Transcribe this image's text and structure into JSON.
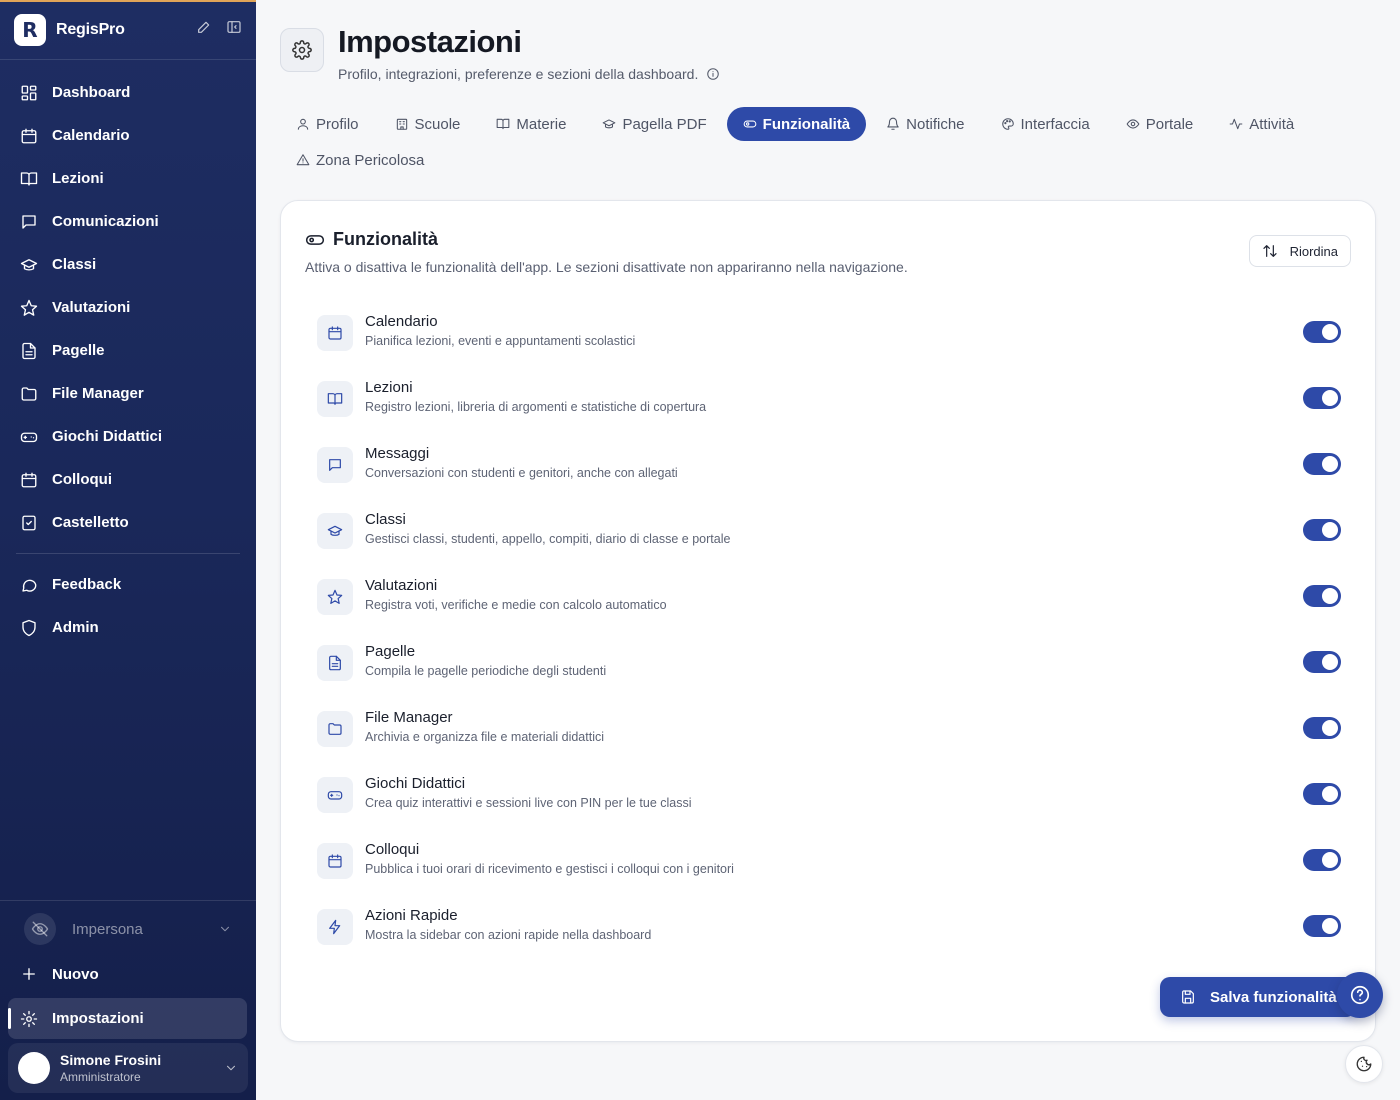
{
  "brand": {
    "name": "RegisPro",
    "logo_letter": "R"
  },
  "sidebar": {
    "items": [
      {
        "label": "Dashboard",
        "icon": "dashboard-icon"
      },
      {
        "label": "Calendario",
        "icon": "calendar-icon"
      },
      {
        "label": "Lezioni",
        "icon": "book-open-icon"
      },
      {
        "label": "Comunicazioni",
        "icon": "message-icon"
      },
      {
        "label": "Classi",
        "icon": "graduation-cap-icon"
      },
      {
        "label": "Valutazioni",
        "icon": "star-icon"
      },
      {
        "label": "Pagelle",
        "icon": "file-text-icon"
      },
      {
        "label": "File Manager",
        "icon": "folder-icon"
      },
      {
        "label": "Giochi Didattici",
        "icon": "gamepad-icon"
      },
      {
        "label": "Colloqui",
        "icon": "calendar-check-icon"
      },
      {
        "label": "Castelletto",
        "icon": "clipboard-check-icon"
      }
    ],
    "secondary": [
      {
        "label": "Feedback",
        "icon": "chat-bubble-icon"
      },
      {
        "label": "Admin",
        "icon": "shield-icon"
      }
    ],
    "impersona": "Impersona",
    "nuovo": "Nuovo",
    "active_item": "Impostazioni",
    "user": {
      "name": "Simone Frosini",
      "role": "Amministratore"
    }
  },
  "page": {
    "title": "Impostazioni",
    "subtitle": "Profilo, integrazioni, preferenze e sezioni della dashboard."
  },
  "tabs": [
    {
      "label": "Profilo",
      "icon": "user-icon"
    },
    {
      "label": "Scuole",
      "icon": "school-icon"
    },
    {
      "label": "Materie",
      "icon": "book-icon"
    },
    {
      "label": "Pagella PDF",
      "icon": "graduation-cap-icon"
    },
    {
      "label": "Funzionalità",
      "icon": "toggle-icon",
      "active": true
    },
    {
      "label": "Notifiche",
      "icon": "bell-icon"
    },
    {
      "label": "Interfaccia",
      "icon": "palette-icon"
    },
    {
      "label": "Portale",
      "icon": "eye-icon"
    },
    {
      "label": "Attività",
      "icon": "activity-icon"
    },
    {
      "label": "Zona Pericolosa",
      "icon": "warning-icon"
    }
  ],
  "features_card": {
    "title": "Funzionalità",
    "description": "Attiva o disattiva le funzionalità dell'app. Le sezioni disattivate non appariranno nella navigazione.",
    "reorder_label": "Riordina",
    "save_label": "Salva funzionalità",
    "items": [
      {
        "name": "Calendario",
        "desc": "Pianifica lezioni, eventi e appuntamenti scolastici",
        "enabled": true
      },
      {
        "name": "Lezioni",
        "desc": "Registro lezioni, libreria di argomenti e statistiche di copertura",
        "enabled": true
      },
      {
        "name": "Messaggi",
        "desc": "Conversazioni con studenti e genitori, anche con allegati",
        "enabled": true
      },
      {
        "name": "Classi",
        "desc": "Gestisci classi, studenti, appello, compiti, diario di classe e portale",
        "enabled": true
      },
      {
        "name": "Valutazioni",
        "desc": "Registra voti, verifiche e medie con calcolo automatico",
        "enabled": true
      },
      {
        "name": "Pagelle",
        "desc": "Compila le pagelle periodiche degli studenti",
        "enabled": true
      },
      {
        "name": "File Manager",
        "desc": "Archivia e organizza file e materiali didattici",
        "enabled": true
      },
      {
        "name": "Giochi Didattici",
        "desc": "Crea quiz interattivi e sessioni live con PIN per le tue classi",
        "enabled": true
      },
      {
        "name": "Colloqui",
        "desc": "Pubblica i tuoi orari di ricevimento e gestisci i colloqui con i genitori",
        "enabled": true
      },
      {
        "name": "Azioni Rapide",
        "desc": "Mostra la sidebar con azioni rapide nella dashboard",
        "enabled": true
      }
    ]
  },
  "colors": {
    "sidebar_bg": "#1e2d62",
    "accent": "#2e4aa8",
    "top_stripe": "#e0a458"
  }
}
